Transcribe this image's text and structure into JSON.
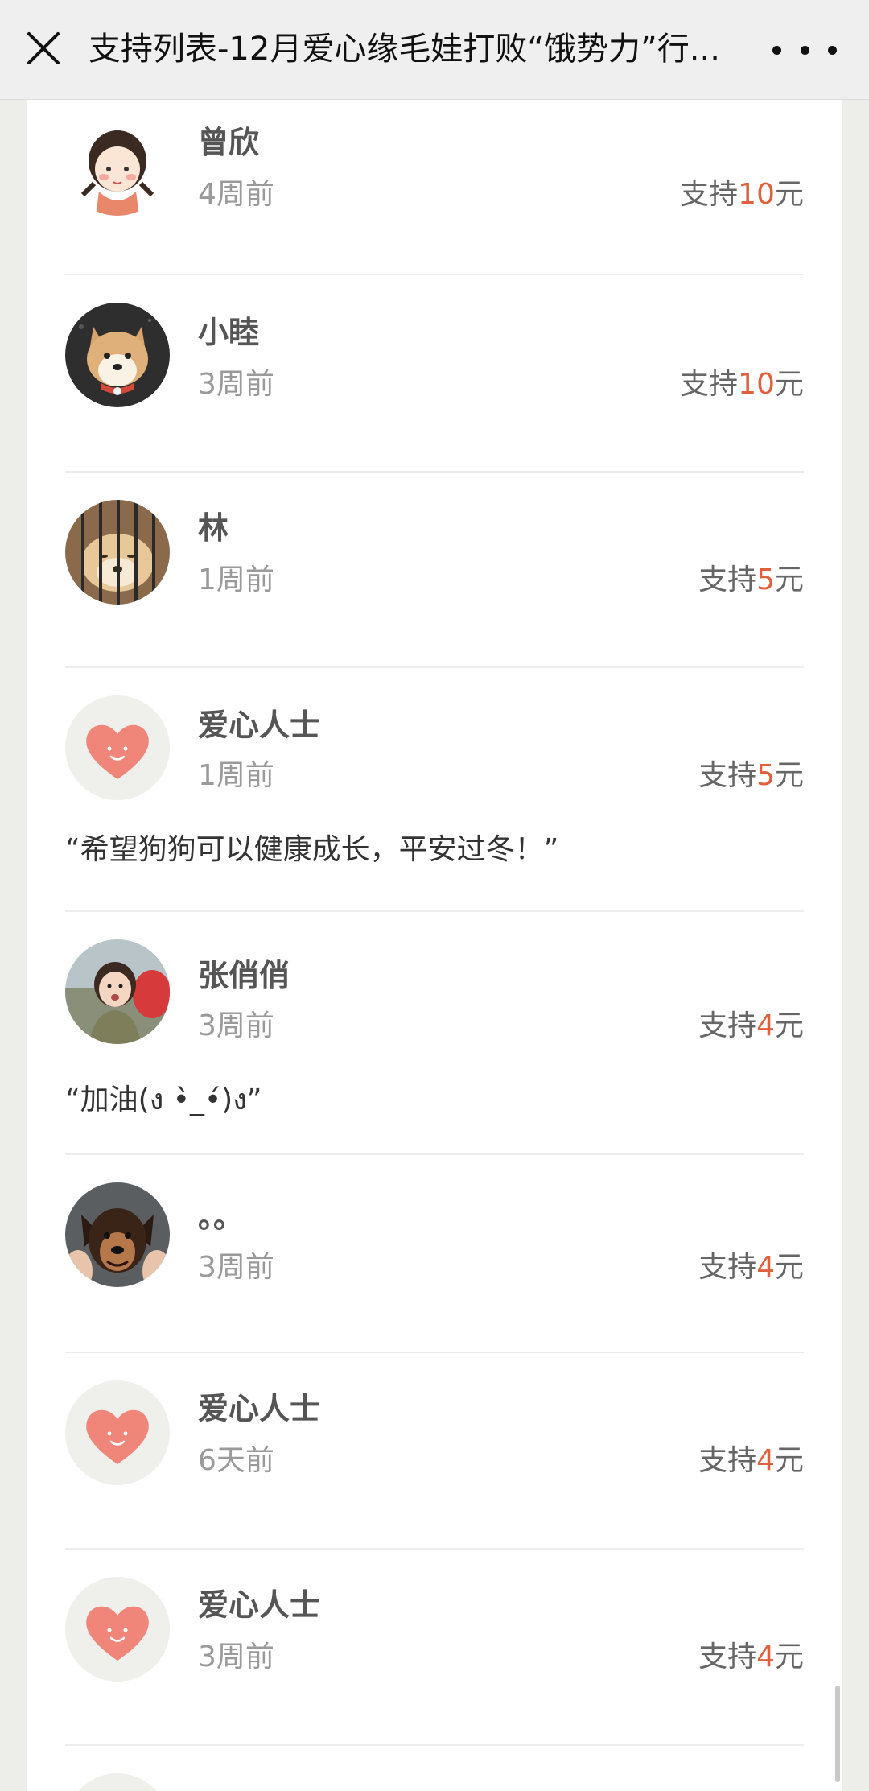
{
  "header": {
    "title": "支持列表-12月爱心缘毛娃打败“饿势力”行..."
  },
  "supporters": [
    {
      "name": "曾欣",
      "time": "4周前",
      "amount_prefix": "支持",
      "amount": "10",
      "amount_suffix": "元",
      "avatar": "cartoon-girl-avatar"
    },
    {
      "name": "小睦",
      "time": "3周前",
      "amount_prefix": "支持",
      "amount": "10",
      "amount_suffix": "元",
      "avatar": "shiba-dog-avatar"
    },
    {
      "name": "林",
      "time": "1周前",
      "amount_prefix": "支持",
      "amount": "5",
      "amount_suffix": "元",
      "avatar": "caged-dog-avatar"
    },
    {
      "name": "爱心人士",
      "time": "1周前",
      "amount_prefix": "支持",
      "amount": "5",
      "amount_suffix": "元",
      "avatar": "heart-avatar",
      "message": "“希望狗狗可以健康成长，平安过冬！”"
    },
    {
      "name": "张俏俏",
      "time": "3周前",
      "amount_prefix": "支持",
      "amount": "4",
      "amount_suffix": "元",
      "avatar": "child-photo-avatar",
      "message": "“加油(ง •̀_•́)ง”"
    },
    {
      "name": "。。",
      "time": "3周前",
      "amount_prefix": "支持",
      "amount": "4",
      "amount_suffix": "元",
      "avatar": "dog-photo-avatar"
    },
    {
      "name": "爱心人士",
      "time": "6天前",
      "amount_prefix": "支持",
      "amount": "4",
      "amount_suffix": "元",
      "avatar": "heart-avatar"
    },
    {
      "name": "爱心人士",
      "time": "3周前",
      "amount_prefix": "支持",
      "amount": "4",
      "amount_suffix": "元",
      "avatar": "heart-avatar"
    }
  ],
  "colors": {
    "amount_highlight": "#e0603e",
    "heart": "#f0857a",
    "background": "#edede9"
  }
}
